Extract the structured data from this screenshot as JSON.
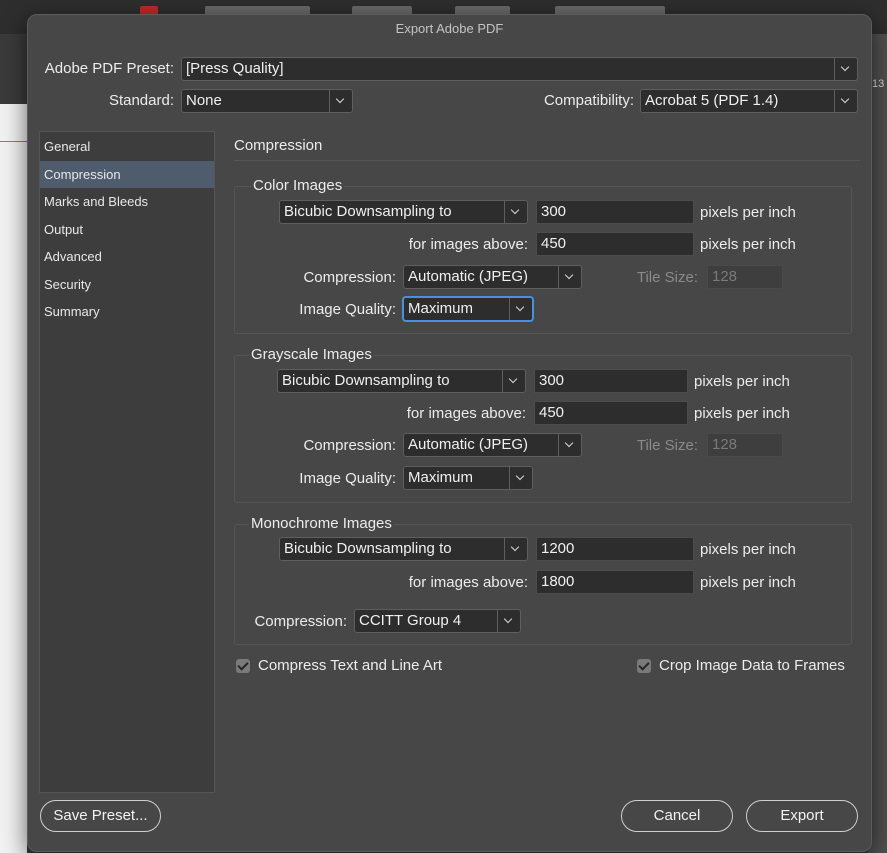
{
  "dialog": {
    "title": "Export Adobe PDF"
  },
  "background": {
    "ruler_number": "13"
  },
  "top": {
    "preset_label": "Adobe PDF Preset:",
    "preset_value": "[Press Quality]",
    "standard_label": "Standard:",
    "standard_value": "None",
    "compat_label": "Compatibility:",
    "compat_value": "Acrobat 5 (PDF 1.4)"
  },
  "sidebar": {
    "items": [
      {
        "label": "General"
      },
      {
        "label": "Compression"
      },
      {
        "label": "Marks and Bleeds"
      },
      {
        "label": "Output"
      },
      {
        "label": "Advanced"
      },
      {
        "label": "Security"
      },
      {
        "label": "Summary"
      }
    ],
    "selected_index": 1
  },
  "panel": {
    "title": "Compression"
  },
  "color_images": {
    "title": "Color Images",
    "sampling": "Bicubic Downsampling to",
    "ppi": "300",
    "ppi_unit": "pixels per inch",
    "above_label": "for images above:",
    "above": "450",
    "above_unit": "pixels per inch",
    "compression_label": "Compression:",
    "compression": "Automatic (JPEG)",
    "tile_label": "Tile Size:",
    "tile": "128",
    "quality_label": "Image Quality:",
    "quality": "Maximum"
  },
  "grayscale_images": {
    "title": "Grayscale Images",
    "sampling": "Bicubic Downsampling to",
    "ppi": "300",
    "ppi_unit": "pixels per inch",
    "above_label": "for images above:",
    "above": "450",
    "above_unit": "pixels per inch",
    "compression_label": "Compression:",
    "compression": "Automatic (JPEG)",
    "tile_label": "Tile Size:",
    "tile": "128",
    "quality_label": "Image Quality:",
    "quality": "Maximum"
  },
  "monochrome_images": {
    "title": "Monochrome Images",
    "sampling": "Bicubic Downsampling to",
    "ppi": "1200",
    "ppi_unit": "pixels per inch",
    "above_label": "for images above:",
    "above": "1800",
    "above_unit": "pixels per inch",
    "compression_label": "Compression:",
    "compression": "CCITT Group 4"
  },
  "options": {
    "compress_text": "Compress Text and Line Art",
    "compress_text_checked": true,
    "crop_image": "Crop Image Data to Frames",
    "crop_image_checked": true
  },
  "buttons": {
    "save_preset": "Save Preset...",
    "cancel": "Cancel",
    "export": "Export"
  },
  "colors": {
    "dialog_bg": "#474747",
    "selected_item": "#4e5c6e",
    "focus_ring": "#4a90e2"
  }
}
